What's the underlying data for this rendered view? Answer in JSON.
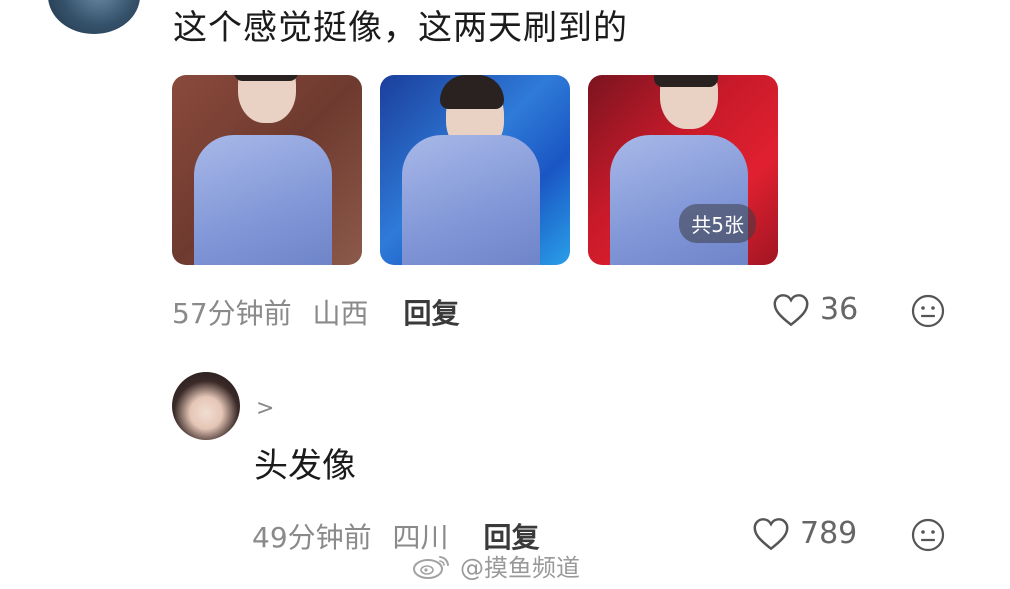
{
  "comment1": {
    "text": "这个感觉挺像，这两天刷到的",
    "image_count_badge": "共5张",
    "time": "57分钟前",
    "location": "山西",
    "reply_label": "回复",
    "likes": "36"
  },
  "comment2": {
    "reply_arrow": ">",
    "text": "头发像",
    "time": "49分钟前",
    "location": "四川",
    "reply_label": "回复",
    "likes": "789"
  },
  "watermark": {
    "text": "@摸鱼频道"
  },
  "icons": {
    "like": "heart-outline-icon",
    "react": "smiley-face-icon",
    "watermark_logo": "weibo-logo-icon"
  }
}
